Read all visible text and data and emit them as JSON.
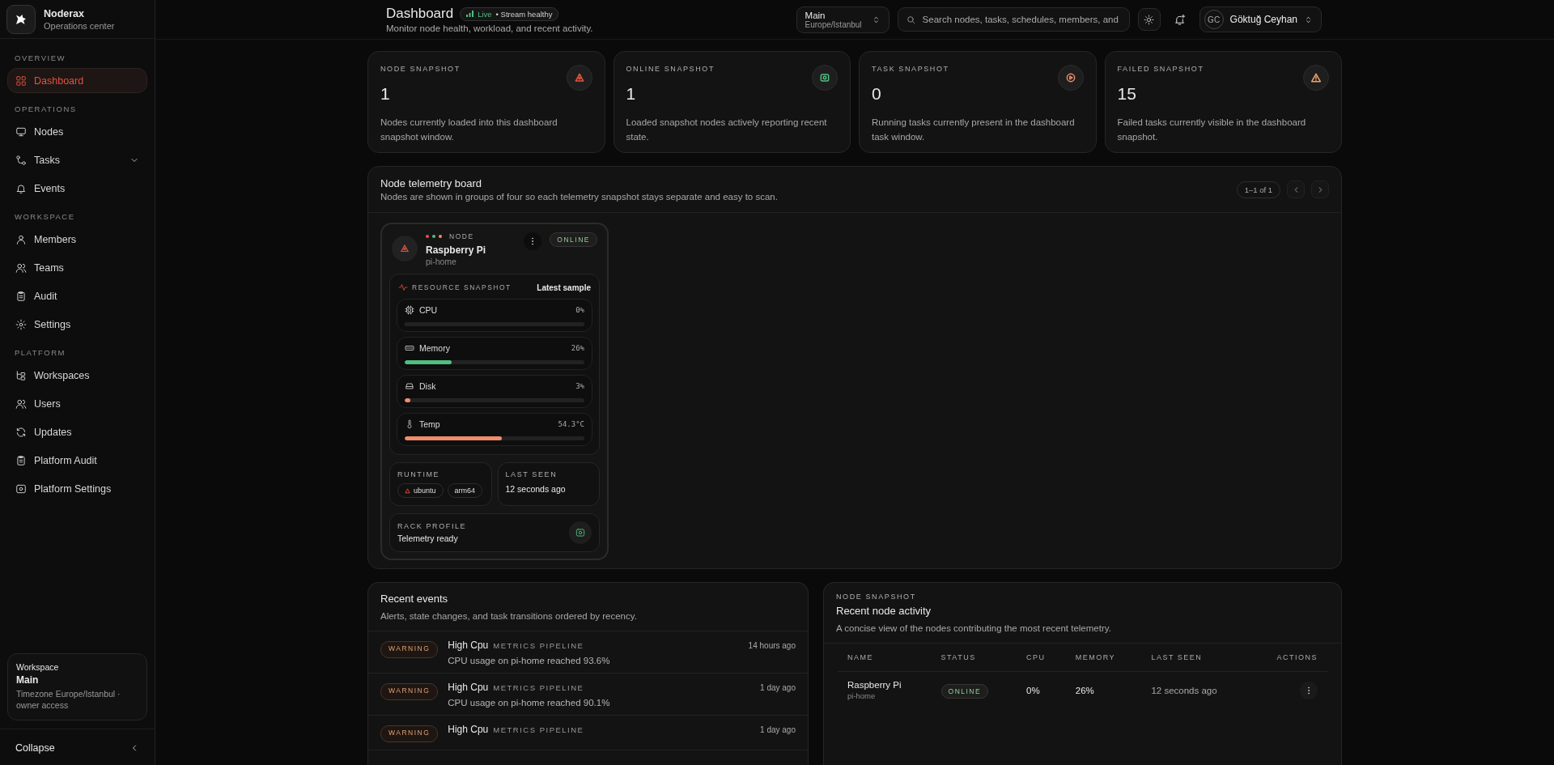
{
  "sidebar": {
    "brand": {
      "name": "Noderax",
      "subtitle": "Operations center"
    },
    "sections": [
      {
        "heading": "OVERVIEW",
        "items": [
          {
            "label": "Dashboard",
            "kind": "link",
            "selected": true
          }
        ]
      },
      {
        "heading": "OPERATIONS",
        "items": [
          {
            "label": "Nodes",
            "kind": "link",
            "selected": false
          },
          {
            "label": "Tasks",
            "kind": "group",
            "selected": false
          },
          {
            "label": "Events",
            "kind": "link",
            "selected": false
          }
        ]
      },
      {
        "heading": "WORKSPACE",
        "items": [
          {
            "label": "Members",
            "kind": "link",
            "selected": false
          },
          {
            "label": "Teams",
            "kind": "link",
            "selected": false
          },
          {
            "label": "Audit",
            "kind": "link",
            "selected": false
          },
          {
            "label": "Settings",
            "kind": "link",
            "selected": false
          }
        ]
      },
      {
        "heading": "PLATFORM",
        "items": [
          {
            "label": "Workspaces",
            "kind": "link",
            "selected": false
          },
          {
            "label": "Users",
            "kind": "link",
            "selected": false
          },
          {
            "label": "Updates",
            "kind": "link",
            "selected": false
          },
          {
            "label": "Platform Audit",
            "kind": "link",
            "selected": false
          },
          {
            "label": "Platform Settings",
            "kind": "link",
            "selected": false
          }
        ]
      }
    ],
    "workspace_card": {
      "label": "Workspace",
      "name": "Main",
      "detail": "Timezone Europe/Istanbul · owner access"
    },
    "collapse": {
      "label": "Collapse"
    }
  },
  "header": {
    "title": "Dashboard",
    "status_badge": {
      "live": "Live",
      "health": "• Stream healthy"
    },
    "subtitle": "Monitor node health, workload, and recent activity.",
    "workspace_select": {
      "name": "Main",
      "timezone": "Europe/Istanbul"
    },
    "search": {
      "placeholder": "Search nodes, tasks, schedules, members, and"
    },
    "user": {
      "initials": "GC",
      "name": "Göktuğ Ceyhan"
    }
  },
  "stats": [
    {
      "label": "NODE SNAPSHOT",
      "value": "1",
      "description": "Nodes currently loaded into this dashboard snapshot window.",
      "color": "#e5533d"
    },
    {
      "label": "ONLINE SNAPSHOT",
      "value": "1",
      "description": "Loaded snapshot nodes actively reporting recent state.",
      "color": "#4fbf7f"
    },
    {
      "label": "TASK SNAPSHOT",
      "value": "0",
      "description": "Running tasks currently present in the dashboard task window.",
      "color": "#f08c6a"
    },
    {
      "label": "FAILED SNAPSHOT",
      "value": "15",
      "description": "Failed tasks currently visible in the dashboard snapshot.",
      "color": "#f0a070"
    }
  ],
  "telemetry_board": {
    "title": "Node telemetry board",
    "subtitle": "Nodes are shown in groups of four so each telemetry snapshot stays separate and easy to scan.",
    "pager": {
      "range": "1–1 of 1"
    },
    "nodes": [
      {
        "dots": [
          {
            "color": "#e5533d"
          },
          {
            "color": "#4fbf7f"
          },
          {
            "color": "#f08c6a"
          }
        ],
        "kicker": "NODE",
        "name": "Raspberry Pi",
        "host": "pi-home",
        "status": "ONLINE",
        "resource": {
          "title": "RESOURCE SNAPSHOT",
          "sample_label": "Latest sample",
          "metrics": [
            {
              "label": "CPU",
              "reading": "0%",
              "level": 0
            },
            {
              "label": "Memory",
              "reading": "26%",
              "level": 0.26,
              "color": "#4fbf7f"
            },
            {
              "label": "Disk",
              "reading": "3%",
              "level": 0.03,
              "color": "#f08c6a"
            },
            {
              "label": "Temp",
              "reading": "54.3°C",
              "level": 0.54,
              "color": "#f08c6a"
            }
          ]
        },
        "runtime": {
          "label": "RUNTIME",
          "tags": [
            "ubuntu",
            "arm64"
          ]
        },
        "last_seen": {
          "label": "LAST SEEN",
          "value": "12 seconds ago"
        },
        "rack_profile": {
          "label": "RACK PROFILE",
          "value": "Telemetry ready"
        }
      }
    ]
  },
  "recent_events": {
    "title": "Recent events",
    "subtitle": "Alerts, state changes, and task transitions ordered by recency.",
    "events": [
      {
        "severity": "WARNING",
        "title": "High Cpu",
        "source": "METRICS PIPELINE",
        "time": "14 hours ago",
        "message": "CPU usage on pi-home reached 93.6%"
      },
      {
        "severity": "WARNING",
        "title": "High Cpu",
        "source": "METRICS PIPELINE",
        "time": "1 day ago",
        "message": "CPU usage on pi-home reached 90.1%"
      },
      {
        "severity": "WARNING",
        "title": "High Cpu",
        "source": "METRICS PIPELINE",
        "time": "1 day ago"
      }
    ]
  },
  "node_activity": {
    "kicker": "NODE SNAPSHOT",
    "title": "Recent node activity",
    "subtitle": "A concise view of the nodes contributing the most recent telemetry.",
    "columns": [
      "NAME",
      "STATUS",
      "CPU",
      "MEMORY",
      "LAST SEEN",
      "ACTIONS"
    ],
    "rows": [
      {
        "name": "Raspberry Pi",
        "host": "pi-home",
        "status": "ONLINE",
        "cpu": "0%",
        "memory": "26%",
        "last_seen": "12 seconds ago"
      }
    ]
  }
}
